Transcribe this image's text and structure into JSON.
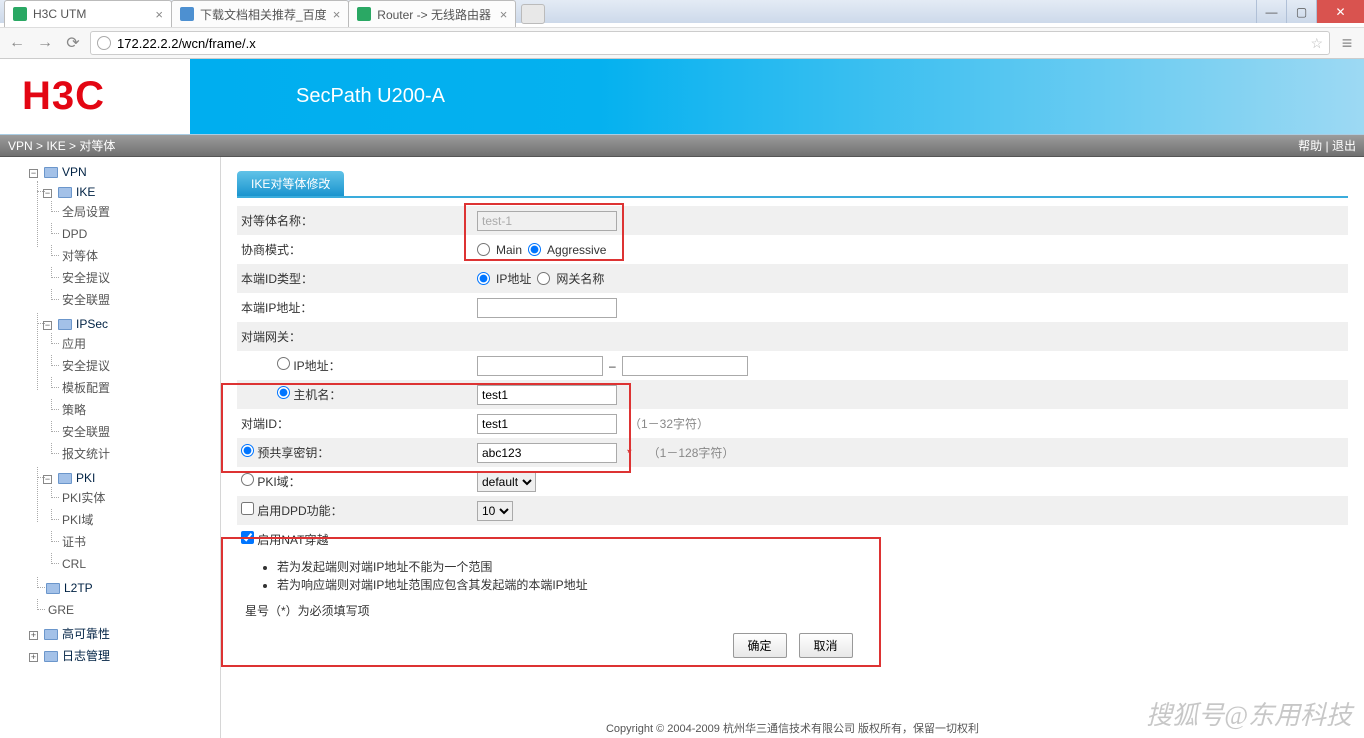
{
  "browser": {
    "tabs": [
      {
        "label": "H3C UTM",
        "favicon": "green"
      },
      {
        "label": "下载文档相关推荐_百度",
        "favicon": "blue"
      },
      {
        "label": "Router -> 无线路由器",
        "favicon": "green"
      }
    ],
    "url": "172.22.2.2/wcn/frame/.x"
  },
  "header": {
    "logo": "H3C",
    "product": "SecPath U200-A"
  },
  "breadcrumb": {
    "items": [
      "VPN",
      "IKE",
      "对等体"
    ],
    "help": "帮助",
    "logout": "退出"
  },
  "sidebar": {
    "vpn": "VPN",
    "ike": "IKE",
    "ike_items": [
      "全局设置",
      "DPD",
      "对等体",
      "安全提议",
      "安全联盟"
    ],
    "ipsec": "IPSec",
    "ipsec_items": [
      "应用",
      "安全提议",
      "模板配置",
      "策略",
      "安全联盟",
      "报文统计"
    ],
    "pki": "PKI",
    "pki_items": [
      "PKI实体",
      "PKI域",
      "证书",
      "CRL"
    ],
    "l2tp": "L2TP",
    "gre": "GRE",
    "ha": "高可靠性",
    "log": "日志管理"
  },
  "form": {
    "tab": "IKE对等体修改",
    "peer_name_label": "对等体名称：",
    "peer_name_value": "test-1",
    "nego_label": "协商模式：",
    "nego_main": "Main",
    "nego_aggr": "Aggressive",
    "localid_label": "本端ID类型：",
    "localid_ip": "IP地址",
    "localid_gw": "网关名称",
    "local_ip_label": "本端IP地址：",
    "remote_gw_label": "对端网关：",
    "remote_ip_label": "IP地址：",
    "dash": "–",
    "remote_host_label": "主机名：",
    "remote_host_value": "test1",
    "remote_id_label": "对端ID：",
    "remote_id_value": "test1",
    "remote_id_hint": "（1－32字符）",
    "psk_label": "预共享密钥：",
    "psk_value": "abc123",
    "psk_hint": "（1－128字符）",
    "pki_label": "PKI域：",
    "pki_default": "default",
    "dpd_label": "启用DPD功能：",
    "dpd_value": "10",
    "nat_label": "启用NAT穿越",
    "note1": "若为发起端则对端IP地址不能为一个范围",
    "note2": "若为响应端则对端IP地址范围应包含其发起端的本端IP地址",
    "footnote": "星号（*）为必须填写项",
    "ok": "确定",
    "cancel": "取消"
  },
  "copyright": "Copyright © 2004-2009 杭州华三通信技术有限公司 版权所有，保留一切权利",
  "watermark": "搜狐号@东用科技"
}
